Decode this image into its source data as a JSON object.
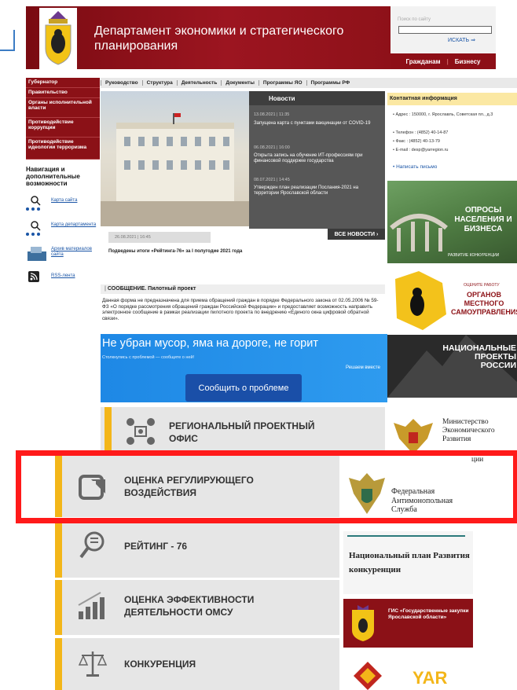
{
  "header": {
    "title": "Департамент экономики и стратегического планирования",
    "search_placeholder": "Поиск по сайту",
    "search_button": "ИСКАТЬ",
    "audience": [
      "Гражданам",
      "Бизнесу"
    ]
  },
  "left_menu": [
    "Губернатор",
    "Правительство",
    "Органы исполнительной власти",
    "Противодействие коррупции",
    "Противодействие идеологии терроризма"
  ],
  "nav_block": {
    "title": "Навигация и дополнительные возможности",
    "links": [
      "Карта сайта",
      "Карта департамента",
      "Архив материалов сайта",
      "RSS-лента"
    ]
  },
  "top_nav": [
    "Руководство",
    "Структура",
    "Деятельность",
    "Документы",
    "Программы ЯО",
    "Программы РФ"
  ],
  "feature_news": {
    "date": "26.08.2021 | 16:45",
    "title": "Подведены итоги «Рейтинга-76» за I полугодие 2021 года"
  },
  "news": {
    "heading": "Новости",
    "items": [
      {
        "date": "13.08.2021 | 11:35",
        "text": "Запущена карта с пунктами вакцинации от COVID-19"
      },
      {
        "date": "06.08.2021 | 16:00",
        "text": "Открыта запись на обучение ИТ-профессиям при финансовой поддержке государства"
      },
      {
        "date": "08.07.2021 | 14:45",
        "text": "Утвержден план реализации Послания-2021 на территории Ярославской области"
      }
    ],
    "all_button": "ВСЕ НОВОСТИ"
  },
  "contacts": {
    "heading": "Контактная информация",
    "address": "Адрес : 150000, г. Ярославль, Советская пл., д.3",
    "phone": "Телефон : (4852) 40-14-87",
    "fax": "Факс : (4852) 40-13-79",
    "email": "E-mail : desp@yarregion.ru",
    "write": "Написать письмо"
  },
  "message": {
    "heading": "СООБЩЕНИЕ. Пилотный проект",
    "text": "Данная форма не предназначена для приема обращений граждан в порядке Федерального закона от 02.05.2006 № 59-ФЗ «О порядке рассмотрения обращений граждан Российской Федерации» и предоставляет возможность направить электронное сообщение в рамках реализации пилотного проекта по внедрению «Единого окна цифровой обратной связи»."
  },
  "problem_banner": {
    "title": "Не убран мусор, яма на дороге, не горит",
    "subtitle": "Столкнулись с проблемой — сообщите о ней!",
    "note": "Решаем вместе",
    "button": "Сообщить о проблеме"
  },
  "right_banners": {
    "opros": "ОПРОСЫ НАСЕЛЕНИЯ И БИЗНЕСА",
    "opros_sub": "РАЗВИТИЕ КОНКУРЕНЦИИ",
    "msu_small": "ОЦЕНИТЕ РАБОТУ",
    "msu": "ОРГАНОВ МЕСТНОГО САМОУПРАВЛЕНИЯ",
    "nproj": "НАЦИОНАЛЬНЫЕ ПРОЕКТЫ РОССИИ"
  },
  "tiles": [
    "РЕГИОНАЛЬНЫЙ ПРОЕКТНЫЙ ОФИС",
    "ОЦЕНКА РЕГУЛИРУЮЩЕГО ВОЗДЕЙСТВИЯ",
    "РЕЙТИНГ - 76",
    "ОЦЕНКА ЭФФЕКТИВНОСТИ ДЕЯТЕЛЬНОСТИ ОМСУ",
    "КОНКУРЕНЦИЯ"
  ],
  "side_logos": {
    "ministry": "Министерство Экономического Развития",
    "ministry_tail": "ции",
    "fas": "Федеральная Антимонопольная Служба",
    "plan": "Национальный план Развития конкуренции",
    "gis": "ГИС «Государственные закупки Ярославской области»",
    "yar": "YAR"
  },
  "colors": {
    "brand_red": "#8b1117",
    "accent_yellow": "#f3b619",
    "highlight": "#ff1a1a"
  }
}
